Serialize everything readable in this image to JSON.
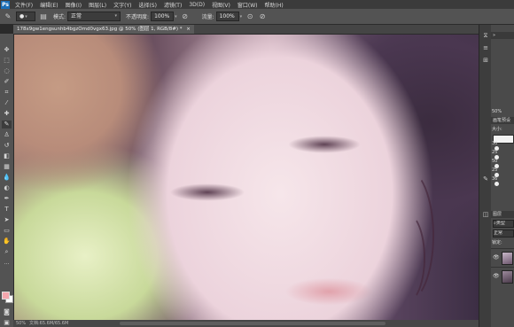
{
  "menubar": {
    "logo": "Ps",
    "items": [
      "文件(F)",
      "编辑(E)",
      "图像(I)",
      "图层(L)",
      "文字(Y)",
      "选择(S)",
      "滤镜(T)",
      "3D(D)",
      "视图(V)",
      "窗口(W)",
      "帮助(H)"
    ]
  },
  "options": {
    "mode_label": "模式:",
    "mode_value": "正常",
    "opacity_label": "不透明度:",
    "opacity_value": "100%",
    "flow_label": "流量:",
    "flow_value": "100%"
  },
  "document": {
    "tab_title": "178x9gw1engsunhb4bgzOmd0vgx63.jpg @ 50% (图层 1, RGB/8#) *"
  },
  "status": {
    "zoom": "50%",
    "doc_size": "文档:65.6M/65.6M"
  },
  "panel": {
    "zoom_value": "50%",
    "brush_tab": "画笔预设",
    "size_label": "大小:",
    "brush_sizes": [
      "30",
      "25",
      "50",
      "25",
      "36"
    ],
    "layers_tab": "图层",
    "kind_label": "类型",
    "blend_mode": "正常",
    "lock_label": "锁定:"
  },
  "colors": {
    "foreground": "#f4a6ad",
    "background": "#ffffff",
    "chrome": "#535353"
  },
  "tools": [
    "move-icon",
    "marquee-icon",
    "lasso-icon",
    "quick-select-icon",
    "crop-icon",
    "eyedropper-icon",
    "healing-icon",
    "brush-icon",
    "clone-stamp-icon",
    "history-brush-icon",
    "eraser-icon",
    "gradient-icon",
    "blur-icon",
    "dodge-icon",
    "pen-icon",
    "type-icon",
    "path-select-icon",
    "shape-icon",
    "hand-icon",
    "zoom-icon"
  ]
}
